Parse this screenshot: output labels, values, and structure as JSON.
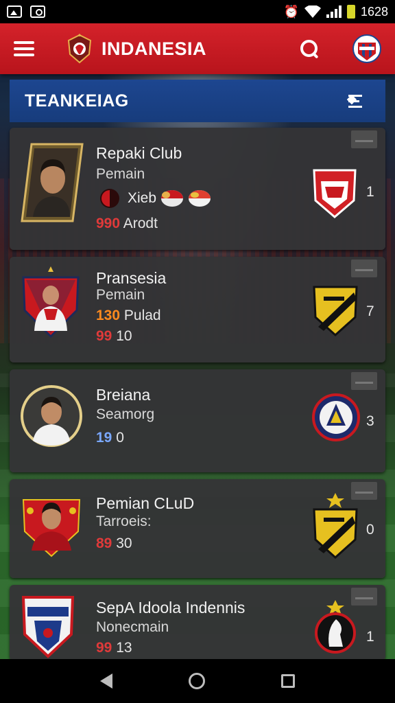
{
  "status_bar": {
    "time": "1628",
    "icons": [
      "image-icon",
      "camera-icon",
      "alarm-icon",
      "wifi-icon",
      "signal-icon",
      "battery-icon"
    ]
  },
  "app_bar": {
    "title": "INDANESIA",
    "menu_icon": "hamburger-icon",
    "search_icon": "search-icon"
  },
  "section": {
    "title": "TEANKEIAG",
    "sort_icon": "sort-collapse-icon"
  },
  "players": [
    {
      "name": "Repaki Club",
      "role": "Pemain",
      "extra_label": "Xieb",
      "stat_num": "990",
      "stat_text": "Arodt",
      "rank": "1"
    },
    {
      "name": "Pransesia",
      "role": "Pemain",
      "extra_num": "130",
      "extra_text": "Pulad",
      "stat_num": "99",
      "stat_text": "10",
      "rank": "7"
    },
    {
      "name": "Breiana",
      "role": "Seamorg",
      "stat_num": "19",
      "stat_text": "0",
      "rank": "3"
    },
    {
      "name": "Pemian CLuD",
      "role": "Tarroeis:",
      "stat_num": "89",
      "stat_text": "30",
      "rank": "0"
    },
    {
      "name": "SepA Idoola Indennis",
      "role": "Nonecmain",
      "stat_num": "99",
      "stat_text": "13",
      "rank": "1"
    }
  ],
  "colors": {
    "app_bar": "#c8191f",
    "section_header": "#1d4690",
    "card_bg": "#343436",
    "stat_red": "#e03a3a"
  }
}
